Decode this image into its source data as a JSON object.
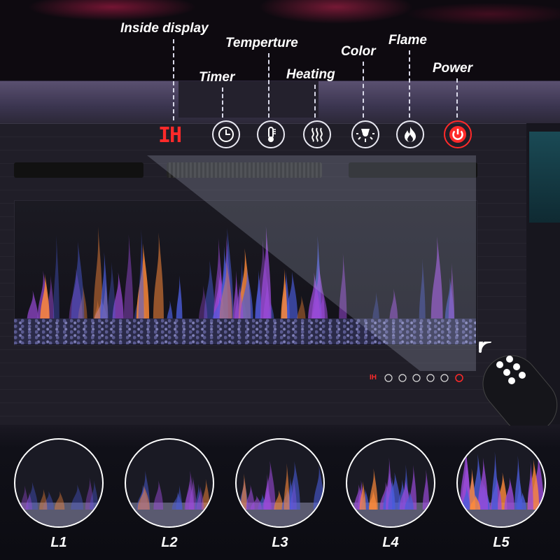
{
  "callouts": {
    "inside_display": "Inside display",
    "timer": "Timer",
    "temperature": "Temperture",
    "heating": "Heating",
    "color": "Color",
    "flame": "Flame",
    "power": "Power"
  },
  "display_readout": "IH",
  "mini_display_readout": "IH",
  "levels": [
    {
      "label": "L1"
    },
    {
      "label": "L2"
    },
    {
      "label": "L3"
    },
    {
      "label": "L4"
    },
    {
      "label": "L5"
    }
  ],
  "colors": {
    "display_red": "#ff2a2a",
    "flame_blue": "#4a5bd8",
    "flame_purple": "#9a4ad8",
    "flame_orange": "#ff8a3a"
  },
  "icons": [
    "timer-icon",
    "thermometer-icon",
    "heating-icon",
    "color-bulb-icon",
    "flame-icon",
    "power-icon",
    "wifi-signal-icon",
    "remote-control-icon"
  ]
}
